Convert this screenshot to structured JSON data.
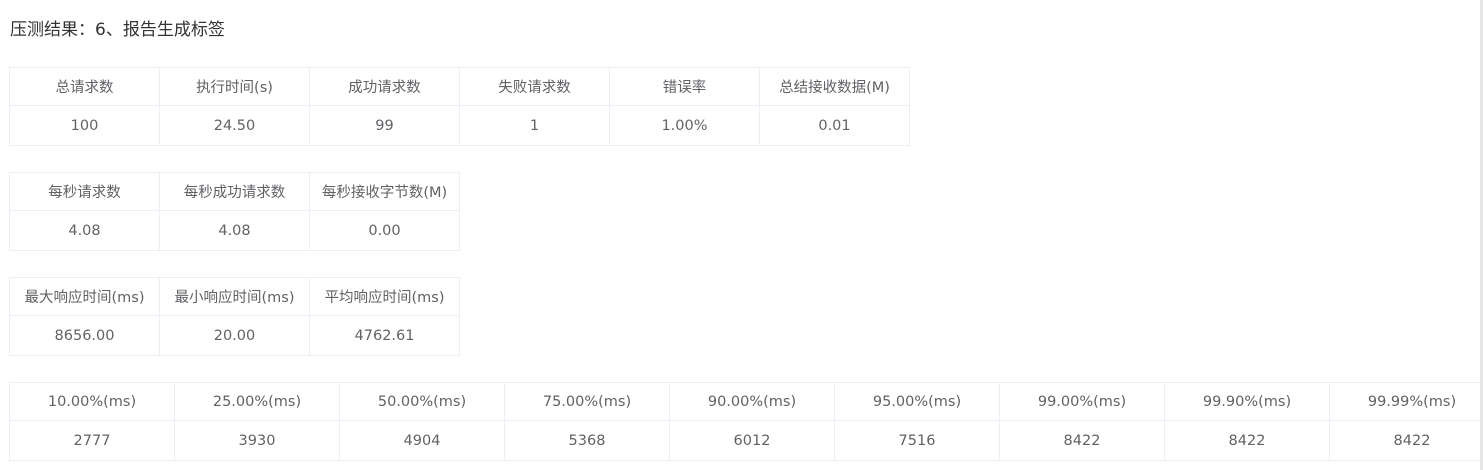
{
  "title": "压测结果：6、报告生成标签",
  "summary_table": {
    "headers": [
      "总请求数",
      "执行时间(s)",
      "成功请求数",
      "失败请求数",
      "错误率",
      "总结接收数据(M)"
    ],
    "values": [
      "100",
      "24.50",
      "99",
      "1",
      "1.00%",
      "0.01"
    ]
  },
  "rate_table": {
    "headers": [
      "每秒请求数",
      "每秒成功请求数",
      "每秒接收字节数(M)"
    ],
    "values": [
      "4.08",
      "4.08",
      "0.00"
    ]
  },
  "response_table": {
    "headers": [
      "最大响应时间(ms)",
      "最小响应时间(ms)",
      "平均响应时间(ms)"
    ],
    "values": [
      "8656.00",
      "20.00",
      "4762.61"
    ]
  },
  "percentile_table": {
    "headers": [
      "10.00%(ms)",
      "25.00%(ms)",
      "50.00%(ms)",
      "75.00%(ms)",
      "90.00%(ms)",
      "95.00%(ms)",
      "99.00%(ms)",
      "99.90%(ms)",
      "99.99%(ms)"
    ],
    "values": [
      "2777",
      "3930",
      "4904",
      "5368",
      "6012",
      "7516",
      "8422",
      "8422",
      "8422"
    ]
  },
  "colors": {
    "border": "#ebeef5",
    "text": "#606266",
    "title": "#333333"
  }
}
